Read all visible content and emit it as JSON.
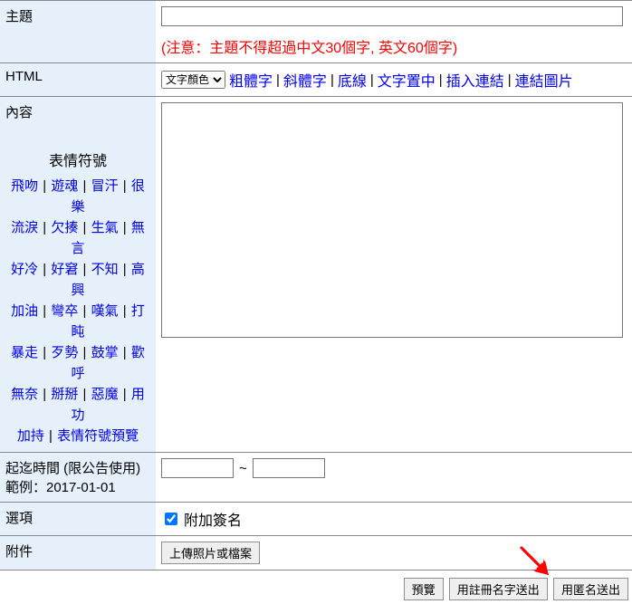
{
  "labels": {
    "subject": "主題",
    "html": "HTML",
    "content": "內容",
    "range": "起迄時間 (限公告使用)",
    "range_ex": "範例：2017-01-01",
    "options": "選項",
    "attachment": "附件"
  },
  "subject_note": "(注意：主題不得超過中文30個字, 英文60個字)",
  "html_tools": {
    "color_select": "文字顏色",
    "bold": "粗體字",
    "italic": "斜體字",
    "underline": "底線",
    "center": "文字置中",
    "insert_link": "插入連結",
    "link_image": "連結圖片"
  },
  "emoticons": {
    "header": "表情符號",
    "rows": [
      [
        "飛吻",
        "遊魂",
        "冒汗",
        "很樂"
      ],
      [
        "流淚",
        "欠揍",
        "生氣",
        "無言"
      ],
      [
        "好冷",
        "好窘",
        "不知",
        "高興"
      ],
      [
        "加油",
        "彎卒",
        "嘆氣",
        "打盹"
      ],
      [
        "暴走",
        "歹勢",
        "鼓掌",
        "歡呼"
      ],
      [
        "無奈",
        "掰掰",
        "惡魔",
        "用功"
      ]
    ],
    "last_row": [
      "加持",
      "表情符號預覽"
    ]
  },
  "range_sep": "~",
  "option_sign": "附加簽名",
  "upload_label": "上傳照片或檔案",
  "buttons": {
    "preview": "預覽",
    "submit_reg": "用註冊名字送出",
    "submit_anon": "用匿名送出"
  }
}
